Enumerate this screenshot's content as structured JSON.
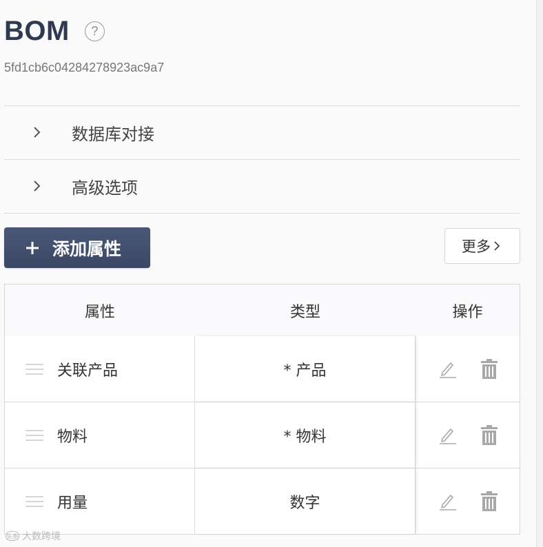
{
  "header": {
    "title": "BOM",
    "help_icon": "question-circle-icon",
    "object_id": "5fd1cb6c04284278923ac9a7"
  },
  "sections": [
    {
      "label": "数据库对接",
      "icon": "chevron-right-icon",
      "expanded": false
    },
    {
      "label": "高级选项",
      "icon": "chevron-right-icon",
      "expanded": false
    }
  ],
  "toolbar": {
    "add_label": "添加属性",
    "add_icon": "plus-icon",
    "more_label": "更多",
    "more_icon": "chevron-right-icon"
  },
  "table": {
    "columns": [
      "属性",
      "类型",
      "操作"
    ],
    "rows": [
      {
        "name": "关联产品",
        "type": "* 产品"
      },
      {
        "name": "物料",
        "type": "* 物料"
      },
      {
        "name": "用量",
        "type": "数字"
      }
    ],
    "row_actions": [
      "edit-icon",
      "trash-icon"
    ]
  },
  "watermark": {
    "text": "大数跨境",
    "logo": "头条"
  },
  "colors": {
    "primary_button": "#3f4c69",
    "title": "#2f3a52",
    "background": "#fafafb",
    "icon_gray": "#a8a8a8"
  }
}
